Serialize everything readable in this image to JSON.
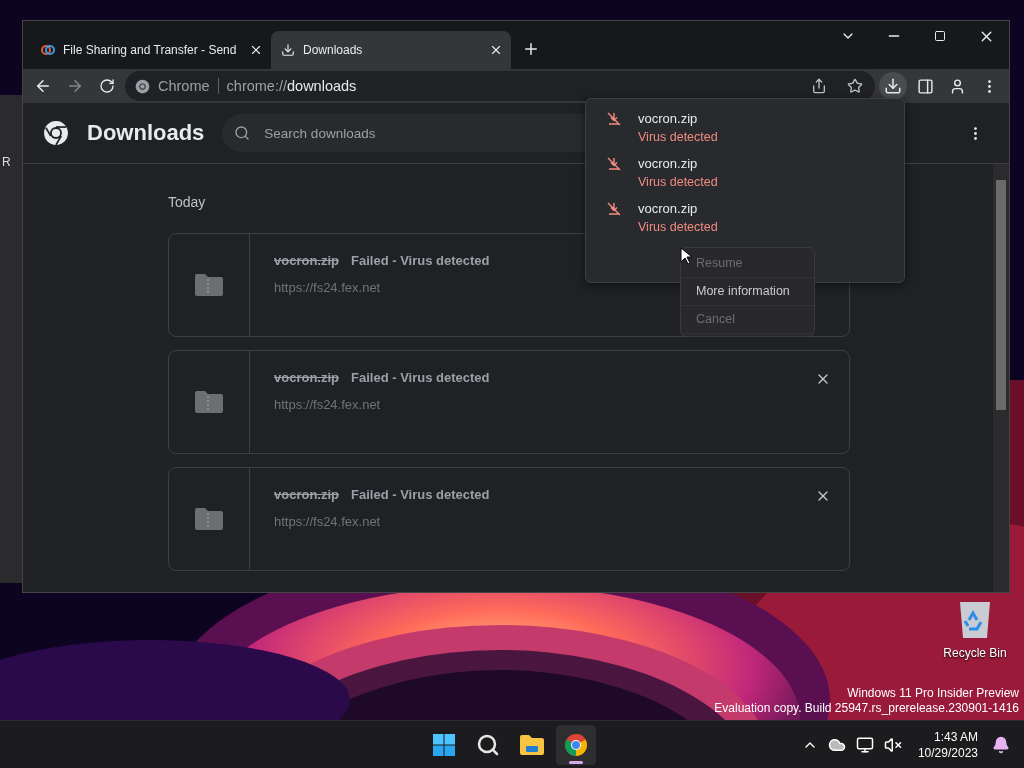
{
  "background_window": {
    "text": "R"
  },
  "browser": {
    "tabs": [
      {
        "title": "File Sharing and Transfer - Send",
        "selected": false
      },
      {
        "title": "Downloads",
        "selected": true
      }
    ],
    "address": {
      "origin_label": "Chrome",
      "url_scheme": "chrome://",
      "url_path": "downloads"
    },
    "page": {
      "title": "Downloads",
      "search_placeholder": "Search downloads",
      "section": "Today",
      "items": [
        {
          "filename": "vocron.zip",
          "status": "Failed - Virus detected",
          "url": "https://fs24.fex.net"
        },
        {
          "filename": "vocron.zip",
          "status": "Failed - Virus detected",
          "url": "https://fs24.fex.net"
        },
        {
          "filename": "vocron.zip",
          "status": "Failed - Virus detected",
          "url": "https://fs24.fex.net"
        }
      ]
    },
    "download_bubble": {
      "items": [
        {
          "filename": "vocron.zip",
          "status": "Virus detected"
        },
        {
          "filename": "vocron.zip",
          "status": "Virus detected"
        },
        {
          "filename": "vocron.zip",
          "status": "Virus detected"
        }
      ]
    },
    "context_menu": {
      "items": [
        {
          "label": "Resume",
          "disabled": true
        },
        {
          "label": "More information",
          "disabled": false
        },
        {
          "label": "Cancel",
          "disabled": true
        }
      ]
    }
  },
  "desktop": {
    "icons": [
      {
        "label": "Recycle Bin"
      }
    ],
    "watermark": [
      "Windows 11 Pro Insider Preview",
      "Evaluation copy. Build 25947.rs_prerelease.230901-1416"
    ]
  },
  "taskbar": {
    "apps": [
      {
        "kind": "start",
        "running": false
      },
      {
        "kind": "search",
        "running": false
      },
      {
        "kind": "explorer",
        "running": false
      },
      {
        "kind": "chrome",
        "running": true
      }
    ],
    "clock": {
      "time": "1:43 AM",
      "date": "10/29/2023"
    }
  }
}
